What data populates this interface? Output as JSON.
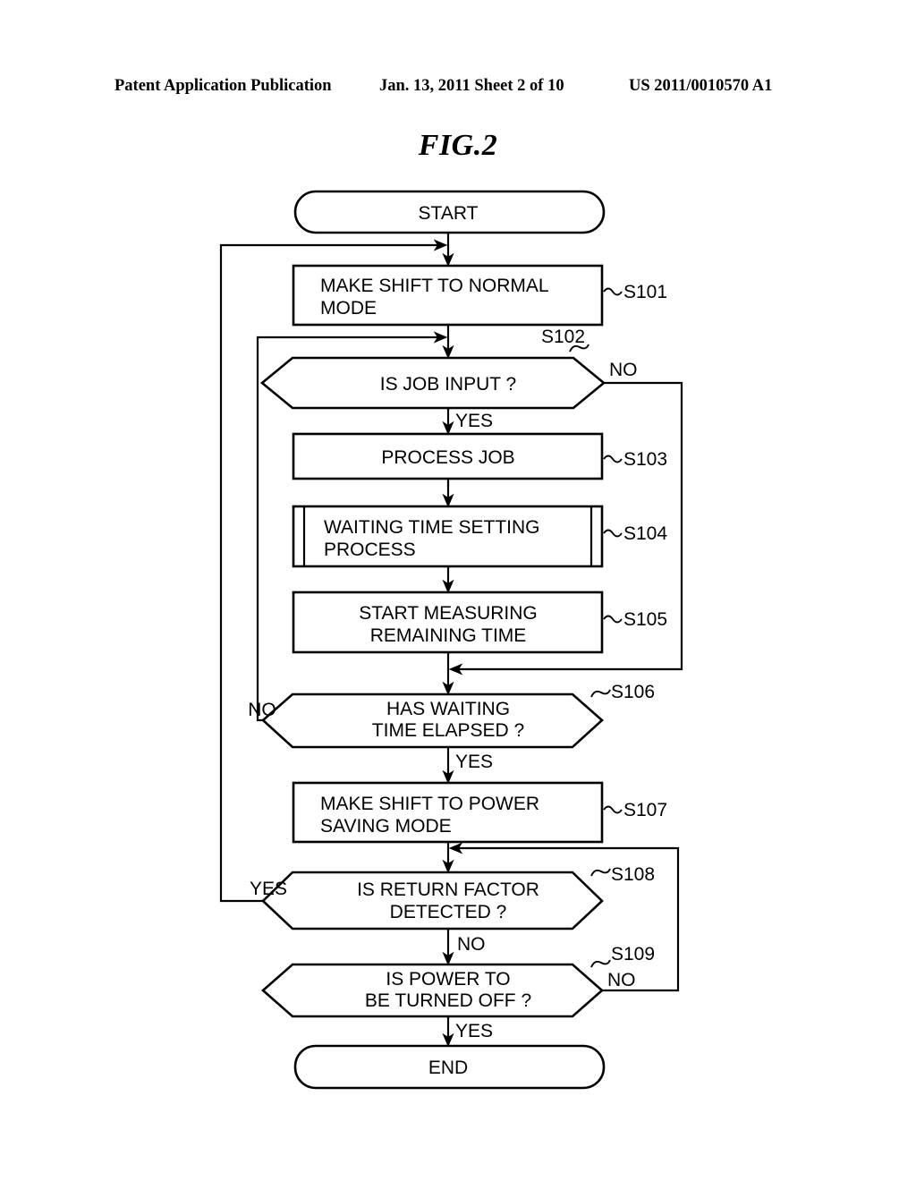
{
  "header": {
    "left": "Patent Application Publication",
    "middle": "Jan. 13, 2011  Sheet 2 of 10",
    "right": "US 2011/0010570 A1"
  },
  "figure": {
    "title": "FIG.2"
  },
  "chart_data": {
    "type": "diagram",
    "diagram_type": "flowchart",
    "title": "FIG.2",
    "nodes": [
      {
        "id": "start",
        "shape": "terminator",
        "label": "START",
        "step": ""
      },
      {
        "id": "s101",
        "shape": "process",
        "label": "MAKE SHIFT TO NORMAL MODE",
        "step": "S101"
      },
      {
        "id": "s102",
        "shape": "decision",
        "label": "IS JOB INPUT ?",
        "step": "S102"
      },
      {
        "id": "s103",
        "shape": "process",
        "label": "PROCESS JOB",
        "step": "S103"
      },
      {
        "id": "s104",
        "shape": "predefined-process",
        "label": "WAITING TIME SETTING PROCESS",
        "step": "S104"
      },
      {
        "id": "s105",
        "shape": "process",
        "label": "START MEASURING REMAINING TIME",
        "step": "S105"
      },
      {
        "id": "s106",
        "shape": "decision",
        "label": "HAS WAITING TIME ELAPSED ?",
        "step": "S106"
      },
      {
        "id": "s107",
        "shape": "process",
        "label": "MAKE SHIFT TO POWER SAVING MODE",
        "step": "S107"
      },
      {
        "id": "s108",
        "shape": "decision",
        "label": "IS RETURN FACTOR DETECTED ?",
        "step": "S108"
      },
      {
        "id": "s109",
        "shape": "decision",
        "label": "IS POWER TO BE TURNED OFF ?",
        "step": "S109"
      },
      {
        "id": "end",
        "shape": "terminator",
        "label": "END",
        "step": ""
      }
    ],
    "edges": [
      {
        "from": "start",
        "to": "s101",
        "label": ""
      },
      {
        "from": "s101",
        "to": "s102",
        "label": ""
      },
      {
        "from": "s102",
        "to": "s103",
        "label": "YES"
      },
      {
        "from": "s102",
        "to": "s106",
        "label": "NO"
      },
      {
        "from": "s103",
        "to": "s104",
        "label": ""
      },
      {
        "from": "s104",
        "to": "s105",
        "label": ""
      },
      {
        "from": "s105",
        "to": "s106",
        "label": ""
      },
      {
        "from": "s106",
        "to": "s107",
        "label": "YES"
      },
      {
        "from": "s106",
        "to": "s102",
        "label": "NO"
      },
      {
        "from": "s107",
        "to": "s108",
        "label": ""
      },
      {
        "from": "s108",
        "to": "s101",
        "label": "YES"
      },
      {
        "from": "s108",
        "to": "s109",
        "label": "NO"
      },
      {
        "from": "s109",
        "to": "end",
        "label": "YES"
      },
      {
        "from": "s109",
        "to": "s108",
        "label": "NO"
      }
    ]
  },
  "nodes": {
    "start": {
      "label": "START"
    },
    "s101": {
      "line1": "MAKE SHIFT TO NORMAL",
      "line2": "MODE",
      "step": "S101"
    },
    "s102": {
      "line1": "IS JOB INPUT ?",
      "step": "S102",
      "no": "NO",
      "yes": "YES"
    },
    "s103": {
      "line1": "PROCESS JOB",
      "step": "S103"
    },
    "s104": {
      "line1": "WAITING TIME SETTING",
      "line2": "PROCESS",
      "step": "S104"
    },
    "s105": {
      "line1": "START MEASURING",
      "line2": "REMAINING TIME",
      "step": "S105"
    },
    "s106": {
      "line1": "HAS WAITING",
      "line2": "TIME ELAPSED ?",
      "step": "S106",
      "no": "NO",
      "yes": "YES"
    },
    "s107": {
      "line1": "MAKE SHIFT TO POWER",
      "line2": "SAVING MODE",
      "step": "S107"
    },
    "s108": {
      "line1": "IS RETURN FACTOR",
      "line2": "DETECTED ?",
      "step": "S108",
      "yes": "YES",
      "no": "NO"
    },
    "s109": {
      "line1": "IS POWER TO",
      "line2": "BE TURNED OFF ?",
      "step": "S109",
      "no": "NO",
      "yes": "YES"
    },
    "end": {
      "label": "END"
    }
  }
}
